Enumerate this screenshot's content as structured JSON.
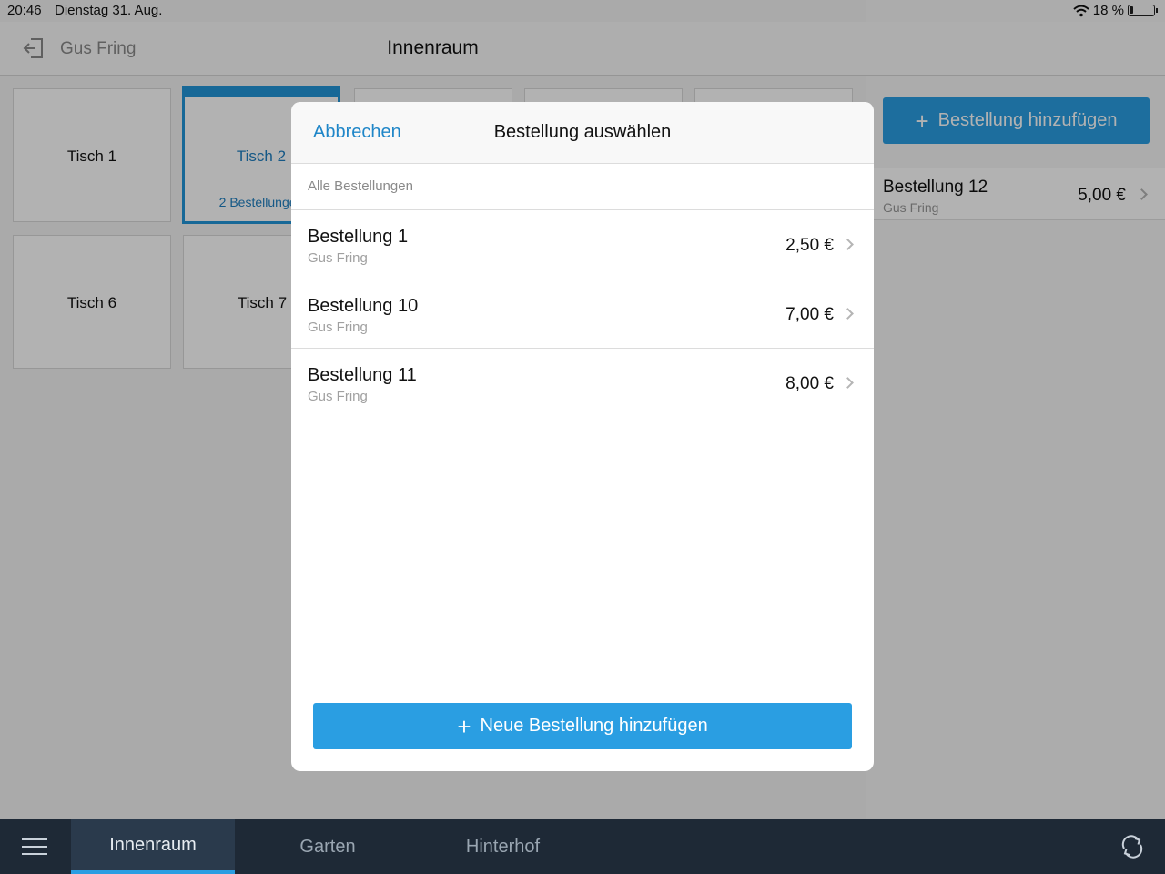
{
  "status_bar": {
    "time": "20:46",
    "date": "Dienstag 31. Aug.",
    "battery": "18 %",
    "icons": [
      "wifi-icon",
      "battery-icon"
    ]
  },
  "header": {
    "user": "Gus Fring",
    "room": "Innenraum",
    "logout_icon": "logout-icon"
  },
  "tables": [
    {
      "label": "Tisch 1",
      "sub": "",
      "active": false
    },
    {
      "label": "Tisch 2",
      "sub": "2 Bestellungen",
      "active": true
    },
    {
      "label": "",
      "sub": "",
      "active": false
    },
    {
      "label": "",
      "sub": "",
      "active": false
    },
    {
      "label": "",
      "sub": "",
      "active": false
    },
    {
      "label": "Tisch 6",
      "sub": "",
      "active": false
    },
    {
      "label": "Tisch 7",
      "sub": "",
      "active": false
    }
  ],
  "sidebar": {
    "add_button": "Bestellung hinzufügen",
    "order": {
      "name": "Bestellung 12",
      "user": "Gus Fring",
      "price": "5,00 €"
    }
  },
  "modal": {
    "cancel": "Abbrechen",
    "title": "Bestellung auswählen",
    "section": "Alle Bestellungen",
    "orders": [
      {
        "name": "Bestellung 1",
        "user": "Gus Fring",
        "price": "2,50 €"
      },
      {
        "name": "Bestellung 10",
        "user": "Gus Fring",
        "price": "7,00 €"
      },
      {
        "name": "Bestellung 11",
        "user": "Gus Fring",
        "price": "8,00 €"
      }
    ],
    "new_order_button": "Neue Bestellung hinzufügen"
  },
  "tabbar": {
    "tabs": [
      "Innenraum",
      "Garten",
      "Hinterhof"
    ],
    "active_tab": "Innenraum",
    "menu_icon": "hamburger-menu-icon",
    "sync_icon": "sync-icon"
  },
  "colors": {
    "accent": "#2a9ee2",
    "tabbar": "#1e2936"
  }
}
